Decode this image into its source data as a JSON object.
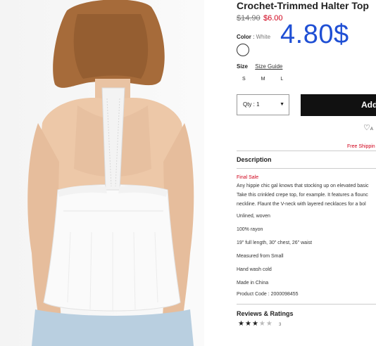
{
  "product": {
    "title": "Crochet-Trimmed Halter Top",
    "price_original": "$14.90",
    "price_sale": "$6.00",
    "promo_price": "4.80$"
  },
  "color": {
    "label": "Color",
    "separator": ":",
    "value": "White",
    "swatch_hex": "#ffffff"
  },
  "size": {
    "label": "Size",
    "guide_link": "Size Guide",
    "options": [
      "S",
      "M",
      "L"
    ]
  },
  "quantity": {
    "label": "Qty : 1",
    "dropdown_icon": "caret-down-icon"
  },
  "actions": {
    "add_label": "Add",
    "wishlist_icon": "heart-icon",
    "wishlist_text": "A"
  },
  "shipping_text": "Free Shippin",
  "description": {
    "heading": "Description",
    "final_sale": "Final Sale",
    "lines": [
      "Any hippie chic gal knows that stocking up on elevated basic",
      "Take this crinkled crepe top, for example. It features a flounc",
      "neckline. Flaunt the V-neck with layered necklaces for a bol"
    ],
    "specs": [
      "Unlined, woven",
      "100% rayon",
      "19\" full length, 30\" chest, 26\" waist",
      "Measured from Small",
      "Hand wash cold",
      "Made in China",
      "Product Code : 2000098455"
    ]
  },
  "reviews": {
    "heading": "Reviews & Ratings",
    "rating": 3,
    "max_rating": 5,
    "count": "3"
  },
  "colors": {
    "sale_red": "#d0021b",
    "promo_blue": "#1f4fd4",
    "button_black": "#111111"
  }
}
